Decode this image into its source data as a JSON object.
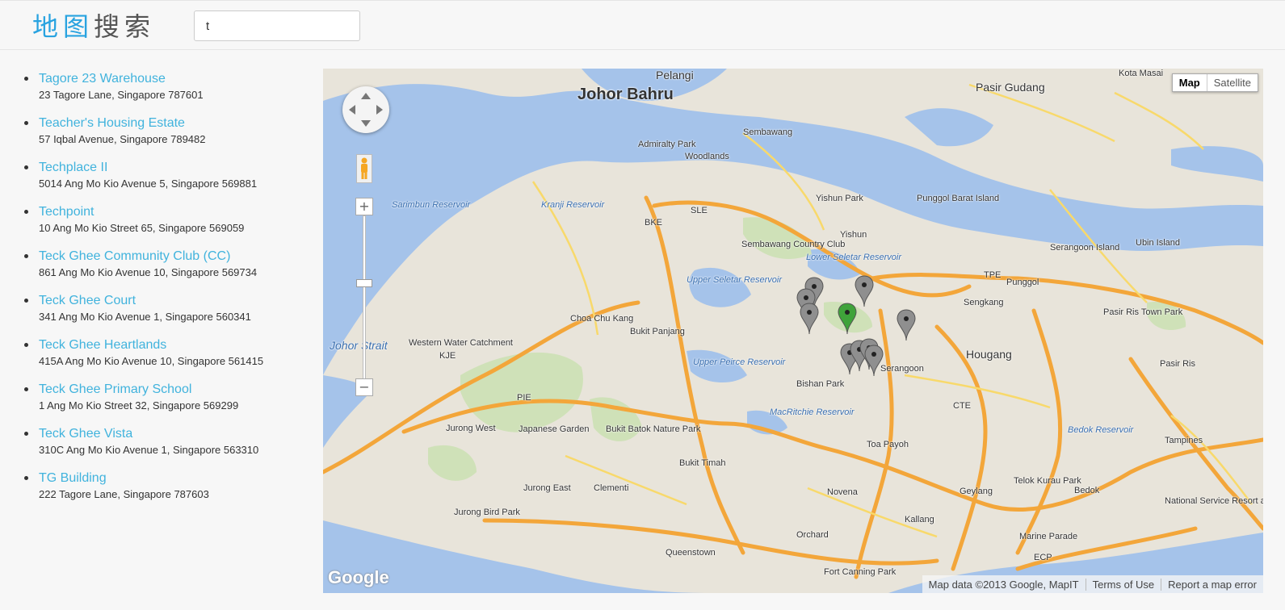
{
  "header": {
    "logo_chars": [
      "地",
      "图",
      "搜",
      "索"
    ],
    "search_value": "t"
  },
  "results": [
    {
      "name": "Tagore 23 Warehouse",
      "address": "23 Tagore Lane, Singapore 787601"
    },
    {
      "name": "Teacher's Housing Estate",
      "address": "57 Iqbal Avenue, Singapore 789482"
    },
    {
      "name": "Techplace II",
      "address": "5014 Ang Mo Kio Avenue 5, Singapore 569881"
    },
    {
      "name": "Techpoint",
      "address": "10 Ang Mo Kio Street 65, Singapore 569059"
    },
    {
      "name": "Teck Ghee Community Club (CC)",
      "address": "861 Ang Mo Kio Avenue 10, Singapore 569734"
    },
    {
      "name": "Teck Ghee Court",
      "address": "341 Ang Mo Kio Avenue 1, Singapore 560341"
    },
    {
      "name": "Teck Ghee Heartlands",
      "address": "415A Ang Mo Kio Avenue 10, Singapore 561415"
    },
    {
      "name": "Teck Ghee Primary School",
      "address": "1 Ang Mo Kio Street 32, Singapore 569299"
    },
    {
      "name": "Teck Ghee Vista",
      "address": "310C Ang Mo Kio Avenue 1, Singapore 563310"
    },
    {
      "name": "TG Building",
      "address": "222 Tagore Lane, Singapore 787603"
    }
  ],
  "map": {
    "type_buttons": {
      "map": "Map",
      "satellite": "Satellite"
    },
    "zoom_in": "+",
    "zoom_out": "−",
    "footer": {
      "data": "Map data ©2013 Google, MapIT",
      "terms": "Terms of Use",
      "report": "Report a map error"
    },
    "logo": "Google",
    "labels": {
      "johor_bahru": "Johor Bahru",
      "pasir_gudang": "Pasir Gudang",
      "pelangi": "Pelangi",
      "kota_masai": "Kota Masai",
      "admiralty_park": "Admiralty Park",
      "sembawang": "Sembawang",
      "woodlands": "Woodlands",
      "yishun_park": "Yishun Park",
      "yishun": "Yishun",
      "punggol_barat": "Punggol Barat Island",
      "sembawang_cc": "Sembawang Country Club",
      "lower_seletar": "Lower Seletar Reservoir",
      "upper_seletar": "Upper Seletar Reservoir",
      "kranji_reservoir": "Kranji Reservoir",
      "sarimbun_reservoir": "Sarimbun Reservoir",
      "choa_chu_kang": "Choa Chu Kang",
      "bukit_panjang": "Bukit Panjang",
      "western_water": "Western Water Catchment",
      "upper_peirce": "Upper Peirce Reservoir",
      "johor_strait": "Johor Strait",
      "bishan_park": "Bishan Park",
      "serangoon": "Serangoon",
      "hougang": "Hougang",
      "sengkang": "Sengkang",
      "punggol": "Punggol",
      "ubin_island": "Ubin Island",
      "serangoon_island": "Serangoon Island",
      "pasir_ris_park": "Pasir Ris Town Park",
      "pasir_ris": "Pasir Ris",
      "jurong_west": "Jurong West",
      "japanese_garden": "Japanese Garden",
      "bukit_batok_np": "Bukit Batok Nature Park",
      "macritchie": "MacRitchie Reservoir",
      "toa_payoh": "Toa Payoh",
      "bukit_timah": "Bukit Timah",
      "tampines": "Tampines",
      "bedok_reservoir": "Bedok Reservoir",
      "jurong_east": "Jurong East",
      "clementi": "Clementi",
      "novena": "Novena",
      "geylang": "Geylang",
      "telok_kurau": "Telok Kurau Park",
      "bedok": "Bedok",
      "national_service": "National Service Resort and Country Club",
      "jurong_bird": "Jurong Bird Park",
      "orchard": "Orchard",
      "kallang": "Kallang",
      "marine_parade": "Marine Parade",
      "queenstown": "Queenstown",
      "fort_canning": "Fort Canning Park",
      "pie": "PIE",
      "cte": "CTE",
      "bke": "BKE",
      "sle": "SLE",
      "tpe": "TPE",
      "kje": "KJE",
      "ecp": "ECP"
    },
    "markers": [
      {
        "color": "gray"
      },
      {
        "color": "gray"
      },
      {
        "color": "gray"
      },
      {
        "color": "gray"
      },
      {
        "color": "green"
      },
      {
        "color": "gray"
      },
      {
        "color": "gray"
      },
      {
        "color": "gray"
      },
      {
        "color": "gray"
      },
      {
        "color": "gray"
      }
    ],
    "colors": {
      "land": "#e8e4da",
      "water": "#a5c3ea",
      "park": "#cfe1b8",
      "expressway": "#f3a63a",
      "road": "#f8d96b",
      "marker_gray": "#8f8f8f",
      "marker_green": "#3fa33a"
    }
  }
}
